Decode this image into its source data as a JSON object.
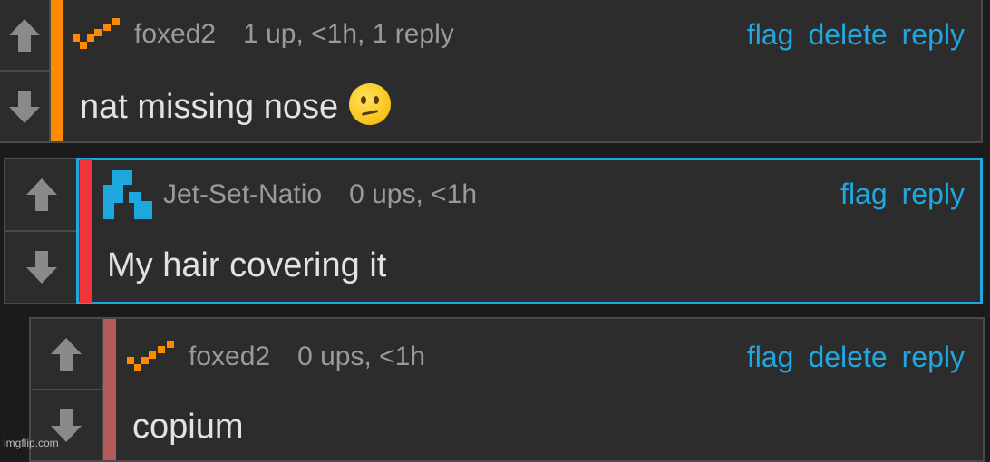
{
  "comments": [
    {
      "username": "foxed2",
      "meta": "1 up, <1h, 1 reply",
      "body": "nat missing nose",
      "emoji": "confused-face",
      "actions": [
        "flag",
        "delete",
        "reply"
      ],
      "accent_color": "#ff8a00"
    },
    {
      "username": "Jet-Set-Natio",
      "meta": "0 ups, <1h",
      "body": "My hair covering it",
      "actions": [
        "flag",
        "reply"
      ],
      "accent_color": "#f0343a",
      "highlight_color": "#1fa8e0"
    },
    {
      "username": "foxed2",
      "meta": "0 ups, <1h",
      "body": "copium",
      "actions": [
        "flag",
        "delete",
        "reply"
      ],
      "accent_color": "#b35a5a"
    }
  ],
  "colors": {
    "link": "#1fa8e0",
    "muted_text": "#9a9a9a",
    "body_text": "#e2e2e2",
    "panel": "#2c2c2c"
  },
  "watermark": "imgflip.com"
}
